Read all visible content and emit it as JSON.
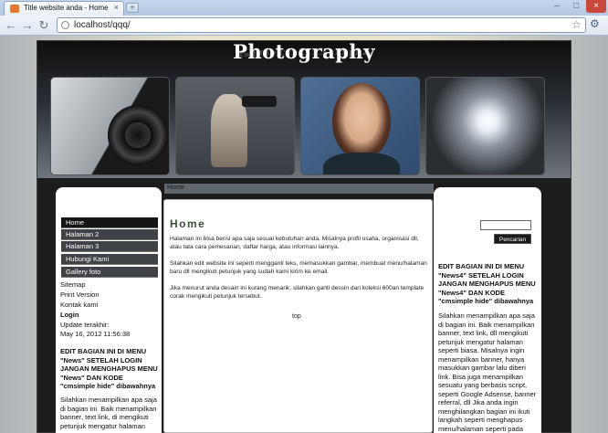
{
  "browser": {
    "tab_title": "Title website anda - Home",
    "tab_close": "×",
    "new_tab": "+",
    "url": "localhost/qqq/",
    "window_controls": [
      "–",
      "□",
      "×"
    ],
    "nav": {
      "back": "←",
      "forward": "→",
      "reload": "↻",
      "star": "☆",
      "wrench": "🔧"
    }
  },
  "site": {
    "logo": "Photography",
    "breadcrumb": "Home",
    "menu": [
      "Home",
      "Halaman 2",
      "Halaman 3",
      "Hubungi Kami",
      "Gallery foto"
    ],
    "left_links": [
      "Sitemap",
      "Print Version",
      "Kontak kami"
    ],
    "login_heading": "Login",
    "update_label": "Update terakhir:",
    "update_value": "May 16, 2012 11:56:38",
    "news_heading": "EDIT BAGIAN INI DI MENU \"News\" SETELAH LOGIN JANGAN MENGHAPUS MENU \"News\" DAN KODE \"cmsimple hide\" dibawahnya",
    "left_news_body": "Silahkan menampilkan apa saja di bagian ini. Baik menampilkan banner, text link, di mengikuti petunjuk mengatur halaman",
    "main_title": "Home",
    "paragraphs": [
      "Halaman ini bisa berisi apa saja sesuai kebutuhan anda. Misalnya profil usaha, organisasi dll, atau tata cara pemesanan, daftar harga, atau informasi lainnya.",
      "Silahkan edit website ini seperti mengganti teks, memasukkan gambar, membuat menu/halaman baru dll mengikuti petunjuk yang sudah kami kirim ke email.",
      "Jika menurut anda desain ini kurang menarik, silahkan ganti dessin dari koleksi 600an template corak mengikuti petunjuk tersebut."
    ],
    "top_link": "top",
    "search_button": "Pencarian",
    "right_news_heading": "EDIT BAGIAN INI DI MENU \"News4\" SETELAH LOGIN JANGAN MENGHAPUS MENU \"News4\" DAN KODE \"cmsimple hide\" dibawahnya",
    "right_news_body": "Silahkan menampilkan apa saja di bagian ini. Baik menampilkan banner, text link, dll mengikuti petunjuk mengatur halaman seperti biasa. Misalnya ingin menampilkan banner, hanya masukkan gambar lalu diberi link. Bisa juga menampilkan sesuatu yang berbasis script, seperti Google Adsense, banner referral, dll Jika anda ingin menghilangkan bagian ini ikuti langkah seperti menghapus menu/halaman seperti pada petunjuk"
  }
}
